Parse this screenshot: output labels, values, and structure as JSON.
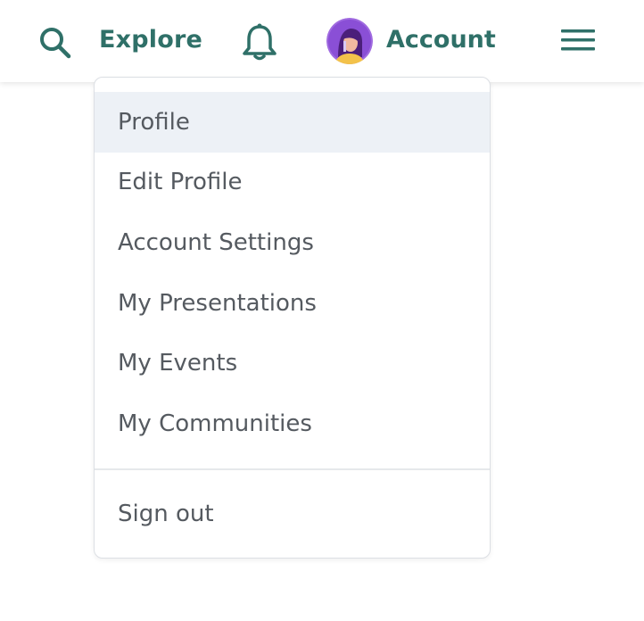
{
  "navbar": {
    "search_icon": "search-icon",
    "explore_label": "Explore",
    "bell_icon": "bell-icon",
    "account_label": "Account",
    "avatar": "user-avatar",
    "menu_icon": "hamburger-menu-icon"
  },
  "colors": {
    "brand": "#2f7068",
    "menu_text": "#555a60",
    "active_bg": "#edf1f6"
  },
  "account_menu": {
    "items": [
      {
        "label": "Profile",
        "active": true
      },
      {
        "label": "Edit Profile"
      },
      {
        "label": "Account Settings"
      },
      {
        "label": "My Presentations"
      },
      {
        "label": "My Events"
      },
      {
        "label": "My Communities"
      }
    ],
    "sign_out_label": "Sign out"
  }
}
